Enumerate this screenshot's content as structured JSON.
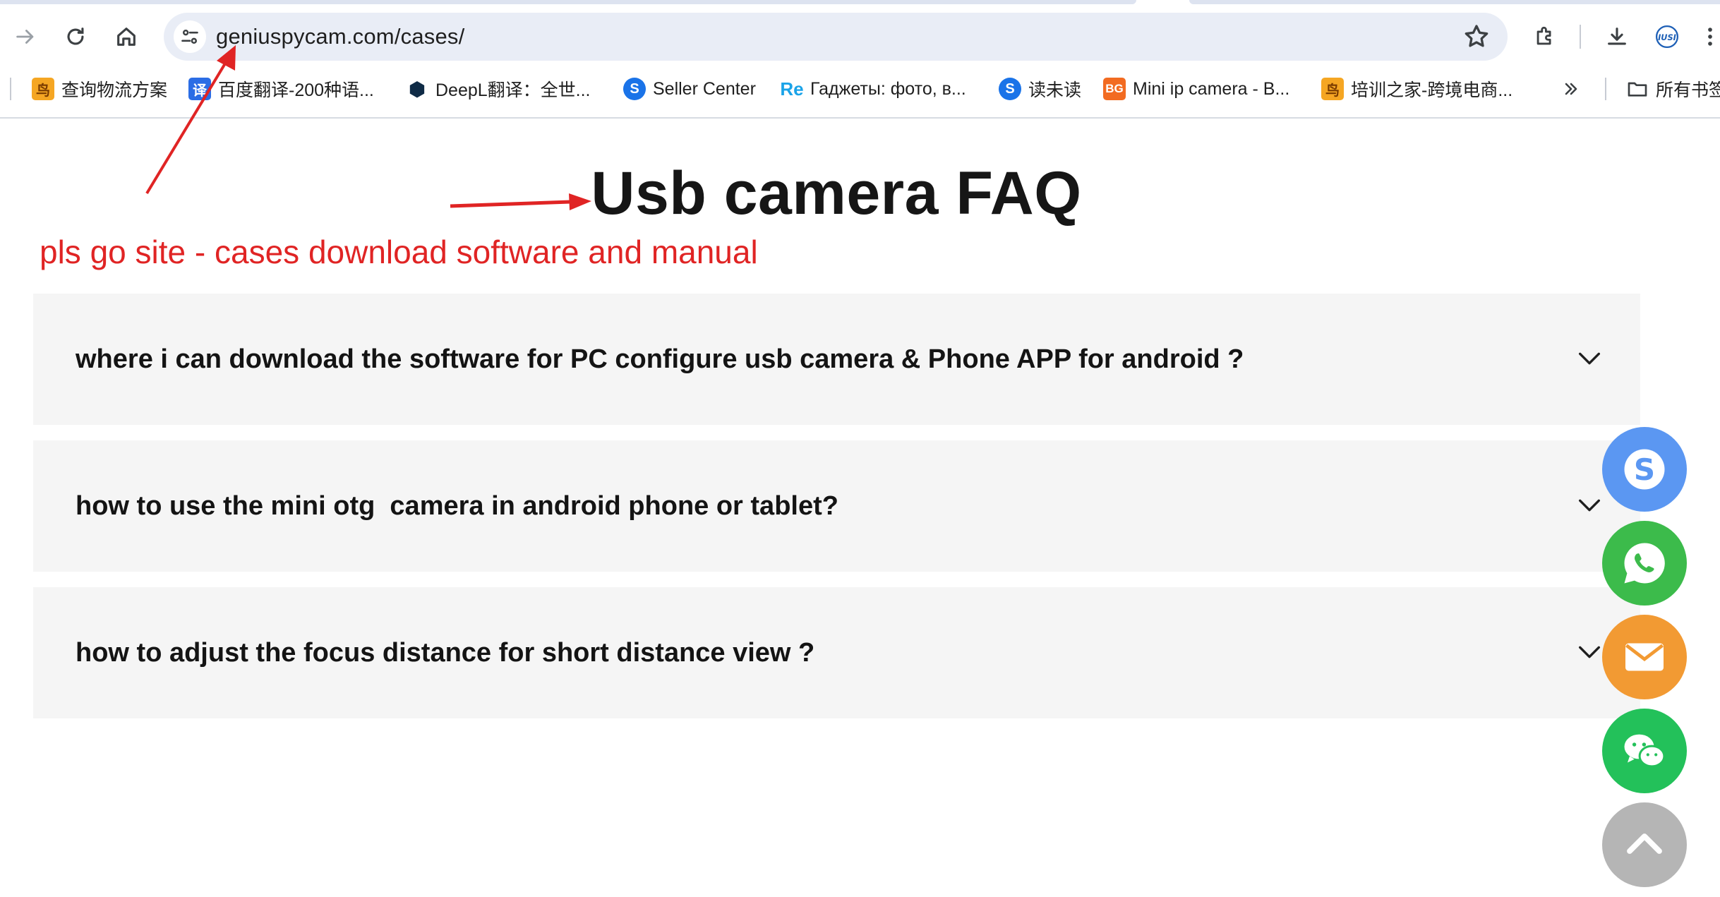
{
  "browser": {
    "url": "geniuspycam.com/cases/",
    "nav": {
      "forward_icon": "arrow-right-icon",
      "reload_icon": "reload-icon",
      "home_icon": "home-icon",
      "site_info_icon": "tune-icon",
      "bookmark_star_icon": "star-icon",
      "extensions_icon": "puzzle-icon",
      "download_icon": "download-icon",
      "profile_icon": "profile-avatar-icon",
      "menu_icon": "more-vert-icon"
    },
    "bookmarks": [
      {
        "label": "查询物流方案",
        "icon": "bird-favicon",
        "color": "#f5a623"
      },
      {
        "label": "百度翻译-200种语...",
        "icon": "baidu-translate-favicon",
        "color": "#2b6de5"
      },
      {
        "label": "DeepL翻译：全世...",
        "icon": "deepl-favicon",
        "color": "#0f2b46"
      },
      {
        "label": "Seller Center",
        "icon": "seller-center-favicon",
        "color": "#1a73e8"
      },
      {
        "label": "Гаджеты: фото, в...",
        "icon": "re-favicon",
        "color": "#1aa3e8"
      },
      {
        "label": "读未读",
        "icon": "reader-favicon",
        "color": "#1a73e8"
      },
      {
        "label": "Mini ip camera - B...",
        "icon": "bg-favicon",
        "color": "#f26b21"
      },
      {
        "label": "培训之家-跨境电商...",
        "icon": "bird-favicon",
        "color": "#f5a623"
      }
    ],
    "overflow_icon": "chevron-double-right-icon",
    "all_bookmarks_label": "所有书签"
  },
  "page": {
    "title": "Usb camera FAQ",
    "annotation": "pls go site - cases download software and manual",
    "annotation_color": "#e02424",
    "faq": [
      {
        "question": "where i can download the software for PC configure usb camera & Phone APP for android ?"
      },
      {
        "question": "how to use the mini otg  camera in android phone or tablet?"
      },
      {
        "question": "how to adjust the focus distance for short distance view ?"
      }
    ]
  },
  "floating_buttons": [
    {
      "name": "skype",
      "icon": "skype-icon",
      "color": "#5b97f2"
    },
    {
      "name": "whatsapp",
      "icon": "whatsapp-icon",
      "color": "#3cbb4b"
    },
    {
      "name": "email",
      "icon": "envelope-icon",
      "color": "#f29a33"
    },
    {
      "name": "wechat",
      "icon": "wechat-icon",
      "color": "#23c15a"
    },
    {
      "name": "back-to-top",
      "icon": "chevron-up-icon",
      "color": "#b5b5b5"
    }
  ]
}
